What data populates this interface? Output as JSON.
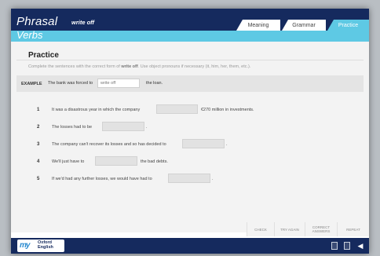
{
  "header": {
    "brand_line1": "Phrasal",
    "brand_line2": "Verbs",
    "topic": "write off",
    "tabs": [
      {
        "label": "Meaning"
      },
      {
        "label": "Grammar"
      },
      {
        "label": "Practice",
        "active": true
      }
    ]
  },
  "main": {
    "title": "Practice",
    "instruction_pre": "Complete the sentences with the correct form of ",
    "instruction_bold": "write off",
    "instruction_post": ". Use object pronouns if necessary (it, him, her, them, etc.).",
    "example": {
      "label": "EXAMPLE",
      "text_before": "The bank was forced to",
      "filled": "write off",
      "text_after": "the loan."
    },
    "questions": [
      {
        "num": "1",
        "before": "It was a disastrous year in which the company",
        "after": "€270 million in investments."
      },
      {
        "num": "2",
        "before": "The losses had to be",
        "after": "."
      },
      {
        "num": "3",
        "before": "The company can't recover its losses and so has decided to",
        "after": "."
      },
      {
        "num": "4",
        "before": "We'll just have to",
        "after": "the bad debts."
      },
      {
        "num": "5",
        "before": "If we'd had any further losses, we would have had to",
        "after": "."
      }
    ]
  },
  "buttons": {
    "check": "CHECK",
    "try_again": "TRY AGAIN",
    "correct_1": "CORRECT",
    "correct_2": "ANSWERS",
    "repeat": "REPEAT"
  },
  "footer": {
    "logo_my": "my",
    "logo_oxford": "Oxford",
    "logo_english": "English",
    "icons": [
      "document-icon",
      "documents-icon",
      "volume-icon"
    ]
  }
}
